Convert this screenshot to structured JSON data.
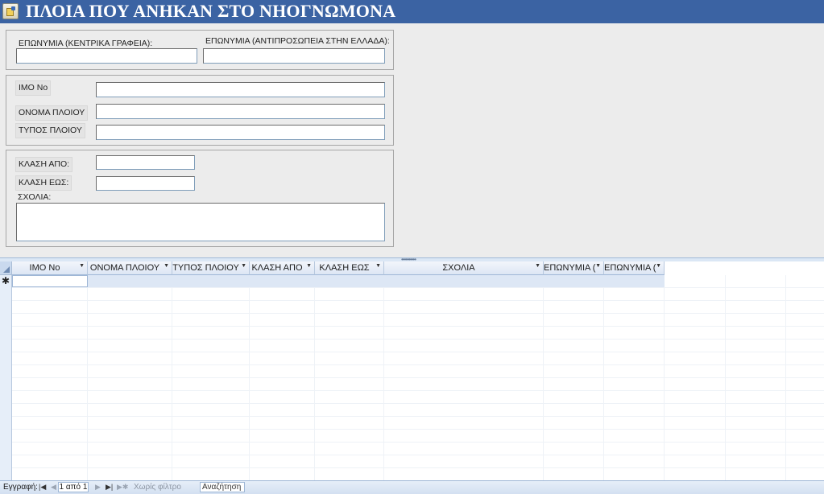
{
  "header": {
    "title": "ΠΛΟΙΑ ΠΟΥ ΑΝΗΚΑΝ ΣΤΟ ΝΗΟΓΝΩΜΟΝΑ",
    "icon": "form-icon"
  },
  "form": {
    "company_hq_label": "ΕΠΩΝΥΜΙΑ (ΚΕΝΤΡΙΚΑ ΓΡΑΦΕΙΑ):",
    "company_hq_value": "",
    "company_gr_label": "ΕΠΩΝΥΜΙΑ (ΑΝΤΙΠΡΟΣΩΠΕΙΑ ΣΤΗΝ ΕΛΛΑΔΑ):",
    "company_gr_value": "",
    "imo_label": "IMO No",
    "imo_value": "",
    "ship_name_label": "ΟΝΟΜΑ ΠΛΟΙΟΥ",
    "ship_name_value": "",
    "ship_type_label": "ΤΥΠΟΣ ΠΛΟΙΟΥ",
    "ship_type_value": "",
    "class_from_label": "ΚΛΑΣΗ ΑΠΟ:",
    "class_from_value": "",
    "class_to_label": "ΚΛΑΣΗ ΕΩΣ:",
    "class_to_value": "",
    "comments_label": "ΣΧΟΛΙΑ:",
    "comments_value": ""
  },
  "splitter": {
    "grip": "••••••••••"
  },
  "datasheet": {
    "columns": [
      "IMO No",
      "ΟΝΟΜΑ ΠΛΟΙΟΥ",
      "ΤΥΠΟΣ ΠΛΟΙΟΥ",
      "ΚΛΑΣΗ ΑΠΟ",
      "ΚΛΑΣΗ ΕΩΣ",
      "ΣΧΟΛΙΑ",
      "ΕΠΩΝΥΜΙΑ (",
      "ΕΠΩΝΥΜΙΑ ("
    ],
    "dropdown_glyph": "▼",
    "new_record_marker": "✱"
  },
  "status_bar": {
    "record_label": "Εγγραφή:",
    "first": "|◀",
    "prev": "◀",
    "record_position": "1 από 1",
    "next": "▶",
    "last": "▶|",
    "new": "▶✱",
    "filter": "Χωρίς φίλτρο",
    "search": "Αναζήτηση"
  },
  "colors": {
    "header_bg": "#3b63a3",
    "datasheet_header": "#dce6f4",
    "status_bg": "#d3e0f1"
  }
}
